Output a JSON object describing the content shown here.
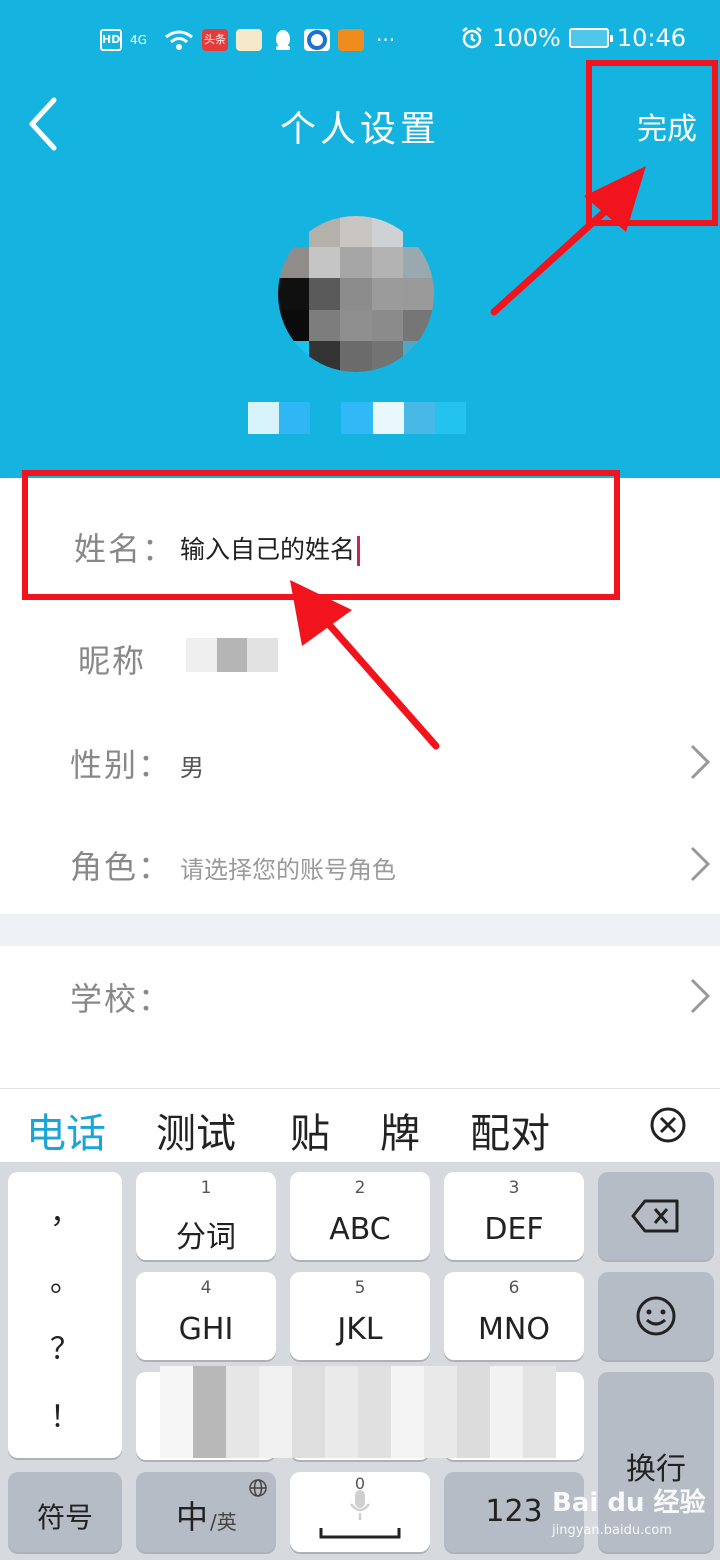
{
  "statusbar": {
    "net": "4G",
    "hd": "HD",
    "app1": "头条",
    "battery": "100%",
    "time": "10:46",
    "more": "···"
  },
  "header": {
    "title": "个人设置",
    "done_label": "完成"
  },
  "form": {
    "name_label": "姓名：",
    "name_value": "输入自己的姓名",
    "nickname_label": "昵称",
    "gender_label": "性别：",
    "gender_value": "男",
    "role_label": "角色：",
    "role_placeholder": "请选择您的账号角色",
    "school_label": "学校："
  },
  "keyboard": {
    "suggestions": [
      "电话",
      "测试",
      "贴",
      "牌",
      "配对"
    ],
    "punct": [
      "，",
      "。",
      "？",
      "！"
    ],
    "keys": [
      {
        "num": "1",
        "label": "分词"
      },
      {
        "num": "2",
        "label": "ABC"
      },
      {
        "num": "3",
        "label": "DEF"
      },
      {
        "num": "4",
        "label": "GHI"
      },
      {
        "num": "5",
        "label": "JKL"
      },
      {
        "num": "6",
        "label": "MNO"
      }
    ],
    "symbol_label": "符号",
    "lang_main": "中",
    "lang_sub": "/英",
    "space_num": "0",
    "num_label": "123",
    "enter_label": "换行"
  },
  "watermark": {
    "brand": "Bai du 经验",
    "url": "jingyan.baidu.com"
  },
  "colors": {
    "header_bg": "#15b4e0",
    "annotation": "#f2141c",
    "cursor": "#c6245a",
    "suggestion_active": "#1aa4d8"
  },
  "icons": [
    "back-arrow-icon",
    "chevron-right-icon",
    "backspace-icon",
    "smiley-icon",
    "microphone-icon",
    "globe-icon",
    "close-circle-icon",
    "alarm-icon",
    "wifi-icon",
    "signal-icon",
    "battery-icon"
  ]
}
